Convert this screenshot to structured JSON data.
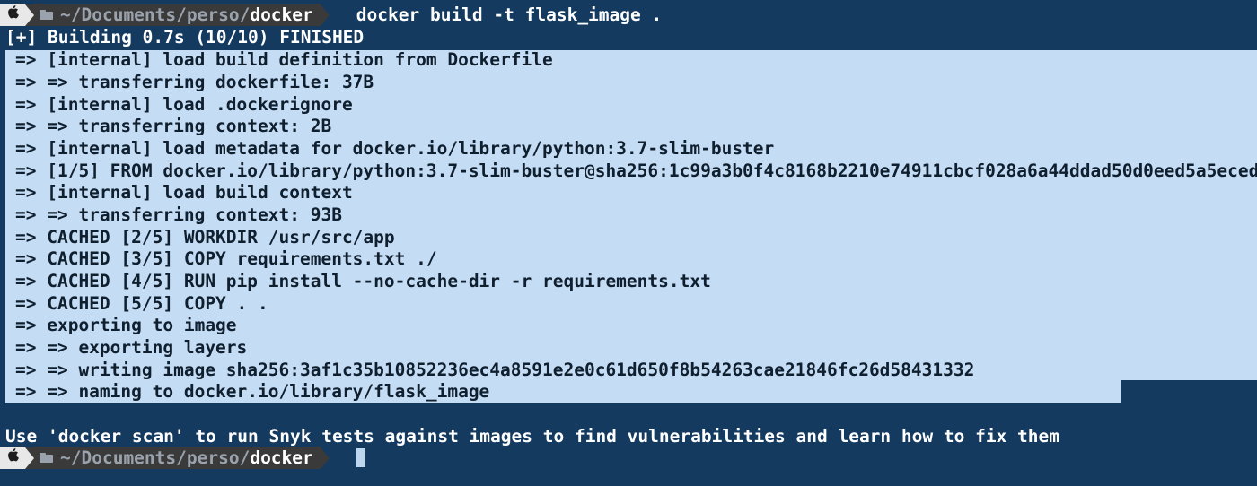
{
  "prompt": {
    "apple_icon": "apple-icon",
    "separator_glyph": "〉",
    "folder_icon": "folder-icon",
    "path_prefix": "~/Documents/perso/",
    "path_current": "docker"
  },
  "command": "docker build -t flask_image .",
  "build_status": "[+] Building 0.7s (10/10) FINISHED",
  "output_lines": [
    "=> [internal] load build definition from Dockerfile",
    "=> => transferring dockerfile: 37B",
    "=> [internal] load .dockerignore",
    "=> => transferring context: 2B",
    "=> [internal] load metadata for docker.io/library/python:3.7-slim-buster",
    "=> [1/5] FROM docker.io/library/python:3.7-slim-buster@sha256:1c99a3b0f4c8168b2210e74911cbcf028a6a44ddad50d0eed5a5eced",
    "=> [internal] load build context",
    "=> => transferring context: 93B",
    "=> CACHED [2/5] WORKDIR /usr/src/app",
    "=> CACHED [3/5] COPY requirements.txt ./",
    "=> CACHED [4/5] RUN pip install --no-cache-dir -r requirements.txt",
    "=> CACHED [5/5] COPY . .",
    "=> exporting to image",
    "=> => exporting layers",
    "=> => writing image sha256:3af1c35b10852236ec4a8591e2e0c61d650f8b54263cae21846fc26d58431332",
    "=> => naming to docker.io/library/flask_image"
  ],
  "scan_hint": "Use 'docker scan' to run Snyk tests against images to find vulnerabilities and learn how to fix them",
  "colors": {
    "background": "#143a5f",
    "selection": "#c5dcf5",
    "prompt_light": "#e8e8e8",
    "prompt_dark": "#3a3a3a"
  }
}
